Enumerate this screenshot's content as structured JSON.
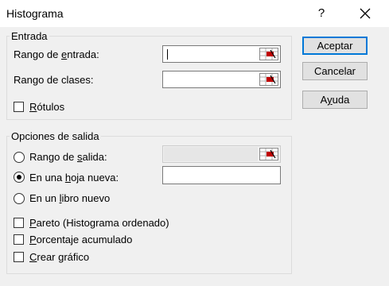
{
  "window": {
    "title": "Histograma",
    "help_glyph": "?",
    "close_icon": "close-icon"
  },
  "entrada": {
    "group_label": "Entrada",
    "rango_entrada": {
      "prefix": "Rango de ",
      "accel": "e",
      "suffix": "ntrada:",
      "value": ""
    },
    "rango_clases": {
      "prefix": "Rango de clases:",
      "value": ""
    },
    "rotulos": {
      "accel": "R",
      "suffix": "ótulos",
      "checked": false
    }
  },
  "salida": {
    "group_label": "Opciones de salida",
    "rango_salida": {
      "prefix": "Rango de ",
      "accel": "s",
      "suffix": "alida:",
      "selected": false,
      "value": ""
    },
    "hoja_nueva": {
      "prefix": "En una ",
      "accel": "h",
      "suffix": "oja nueva:",
      "selected": true,
      "value": ""
    },
    "libro_nuevo": {
      "prefix": "En un ",
      "accel": "l",
      "suffix": "ibro nuevo",
      "selected": false
    }
  },
  "options": {
    "pareto": {
      "accel": "P",
      "suffix": "areto (Histograma ordenado)",
      "checked": false
    },
    "porcentaje": {
      "accel": "P",
      "suffix": "orcentaje acumulado",
      "checked": false
    },
    "grafico": {
      "accel": "C",
      "suffix": "rear gráfico",
      "checked": false
    }
  },
  "buttons": {
    "aceptar": "Aceptar",
    "cancelar": "Cancelar",
    "ayuda_prefix": "A",
    "ayuda_accel": "y",
    "ayuda_suffix": "uda"
  },
  "colors": {
    "accent": "#0078d7",
    "picker_red": "#c00000"
  }
}
